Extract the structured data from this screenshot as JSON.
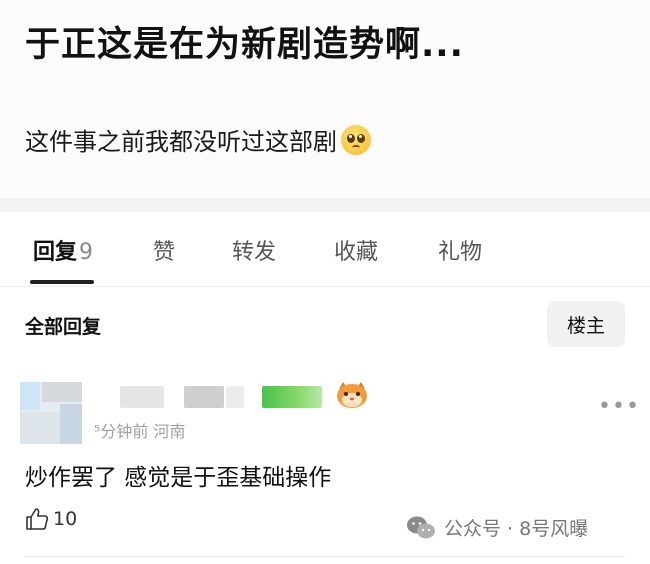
{
  "post": {
    "title": "于正这是在为新剧造势啊...",
    "body": "这件事之前我都没听过这部剧",
    "emoji_icon": "pleading-face-emoji"
  },
  "tabs": [
    {
      "label": "回复",
      "count": "9",
      "active": true
    },
    {
      "label": "赞"
    },
    {
      "label": "转发"
    },
    {
      "label": "收藏"
    },
    {
      "label": "礼物"
    }
  ],
  "filter": {
    "label": "全部回复",
    "op_button": "楼主"
  },
  "comment": {
    "meta_time": "⁵分钟前",
    "meta_location": "河南",
    "text": "炒作罢了 感觉是于歪基础操作",
    "like_count": "10",
    "more_icon": "more-dots-icon",
    "like_icon": "thumbs-up-icon",
    "badge_icon": "cat-badge-icon"
  },
  "watermark": {
    "text": "公众号 · 8号风曝",
    "icon": "wechat-icon"
  },
  "colors": {
    "text": "#111111",
    "secondary": "#a0a0a0",
    "divider": "#f2f2f2",
    "button_bg": "#f1f1f1",
    "name_green": "#49c24b"
  }
}
